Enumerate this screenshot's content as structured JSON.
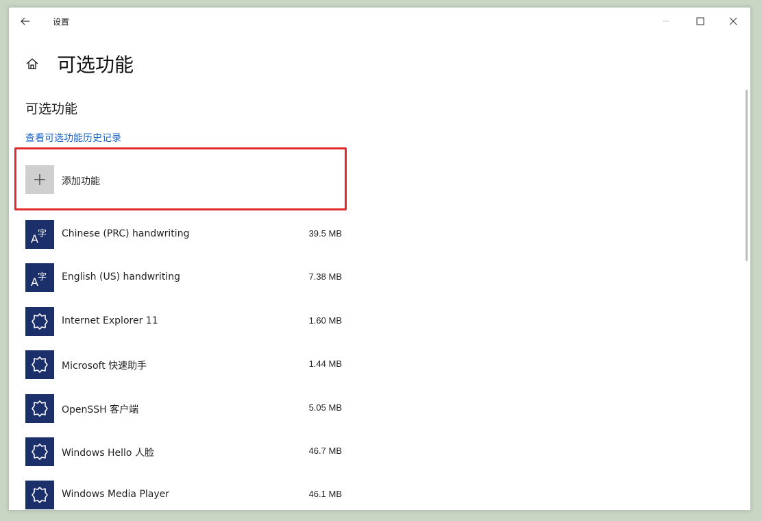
{
  "window": {
    "title": "设置"
  },
  "page": {
    "title": "可选功能"
  },
  "section": {
    "title": "可选功能",
    "history_link": "查看可选功能历史记录"
  },
  "add_feature": {
    "label": "添加功能",
    "icon": "plus-icon"
  },
  "features": [
    {
      "name": "Chinese (PRC) handwriting",
      "size": "39.5 MB",
      "icon": "language-icon"
    },
    {
      "name": "English (US) handwriting",
      "size": "7.38 MB",
      "icon": "language-icon"
    },
    {
      "name": "Internet Explorer 11",
      "size": "1.60 MB",
      "icon": "puzzle-gear-icon"
    },
    {
      "name": "Microsoft 快速助手",
      "size": "1.44 MB",
      "icon": "puzzle-gear-icon"
    },
    {
      "name": "OpenSSH 客户端",
      "size": "5.05 MB",
      "icon": "puzzle-gear-icon"
    },
    {
      "name": "Windows Hello 人脸",
      "size": "46.7 MB",
      "icon": "puzzle-gear-icon"
    },
    {
      "name": "Windows Media Player",
      "size": "46.1 MB",
      "icon": "puzzle-gear-icon"
    }
  ],
  "colors": {
    "accent_link": "#1a63c6",
    "feature_icon_bg": "#1b2f6b",
    "highlight": "#e02a2a"
  }
}
